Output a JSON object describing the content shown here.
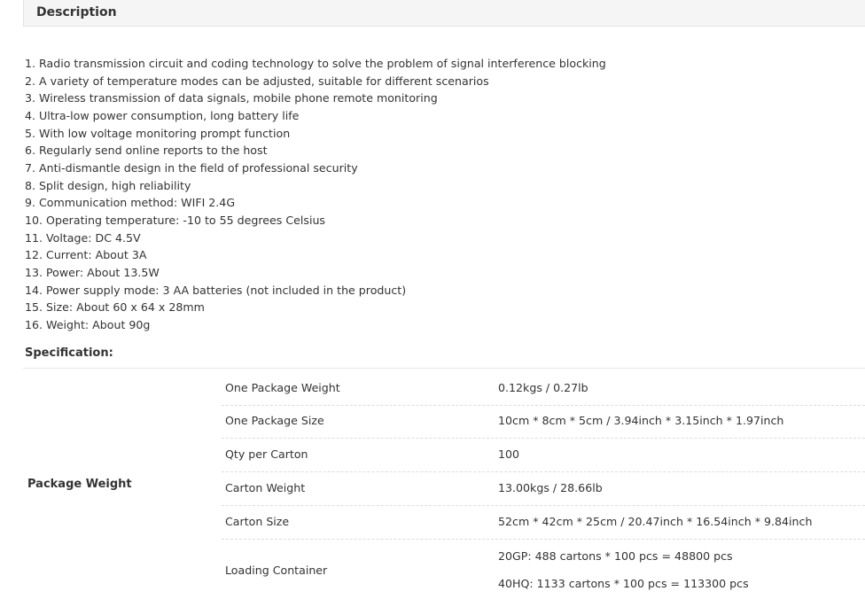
{
  "description": {
    "header": "Description",
    "items": [
      "1. Radio transmission circuit and coding technology to solve the problem of signal interference blocking",
      "2. A variety of temperature modes can be adjusted, suitable for different scenarios",
      "3. Wireless transmission of data signals, mobile phone remote monitoring",
      "4. Ultra-low power consumption, long battery life",
      "5. With low voltage monitoring prompt function",
      "6. Regularly send online reports to the host",
      "7. Anti-dismantle design in the field of professional security",
      "8. Split design, high reliability",
      "9. Communication method: WIFI 2.4G",
      "10. Operating temperature: -10 to 55 degrees Celsius",
      "11. Voltage: DC 4.5V",
      "12. Current: About 3A",
      "13. Power: About 13.5W",
      "14. Power supply mode: 3 AA batteries (not included in the product)",
      "15. Size: About 60 x 64 x 28mm",
      "16. Weight: About 90g"
    ]
  },
  "specification": {
    "title": "Specification:",
    "group_label": "Package Weight",
    "rows": [
      {
        "name": "One Package Weight",
        "value": "0.12kgs / 0.27lb"
      },
      {
        "name": "One Package Size",
        "value": "10cm * 8cm * 5cm / 3.94inch * 3.15inch * 1.97inch"
      },
      {
        "name": "Qty per Carton",
        "value": "100"
      },
      {
        "name": "Carton Weight",
        "value": "13.00kgs / 28.66lb"
      },
      {
        "name": "Carton Size",
        "value": "52cm * 42cm * 25cm / 20.47inch * 16.54inch * 9.84inch"
      },
      {
        "name": "Loading Container",
        "values": [
          "20GP: 488 cartons * 100 pcs = 48800 pcs",
          "40HQ: 1133 cartons * 100 pcs = 113300 pcs"
        ]
      }
    ]
  }
}
